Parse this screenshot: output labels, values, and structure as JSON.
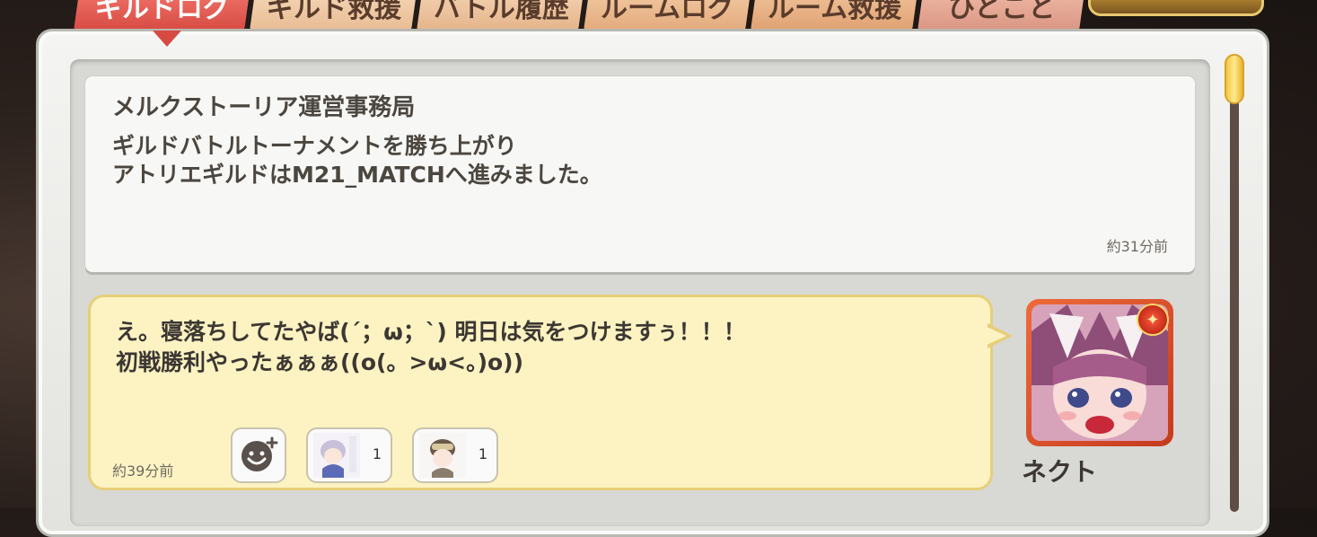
{
  "tabs": [
    {
      "label": "ギルドログ",
      "active": true
    },
    {
      "label": "ギルド救援",
      "active": false
    },
    {
      "label": "バトル履歴",
      "active": false
    },
    {
      "label": "ルームログ",
      "active": false
    },
    {
      "label": "ルーム救援",
      "active": false
    },
    {
      "label": "ひとこと",
      "active": false
    }
  ],
  "system_message": {
    "sender": "メルクストーリア運営事務局",
    "lines": [
      "ギルドバトルトーナメントを勝ち上がり",
      "アトリエギルドはM21_MATCHへ進みました。"
    ],
    "time": "約31分前"
  },
  "chat_message": {
    "lines": [
      "え。寝落ちしてたやば(´；ω；`) 明日は気をつけますぅ！！！",
      "初戦勝利やったぁぁぁ((o(。>ω<。)o))"
    ],
    "time": "約39分前",
    "reactions": [
      {
        "icon": "chibi-girl-sticker-icon",
        "count": "1"
      },
      {
        "icon": "chibi-pilot-girl-sticker-icon",
        "count": "1"
      }
    ],
    "author": "ネクト",
    "author_badge_icon": "fire-element-icon"
  },
  "colors": {
    "active_tab": "#d64a42",
    "bubble_bg": "#fdf3c2",
    "bubble_border": "#e6cf78",
    "system_card_bg": "#f7f7f5",
    "scroll_thumb": "#f3c64a"
  }
}
